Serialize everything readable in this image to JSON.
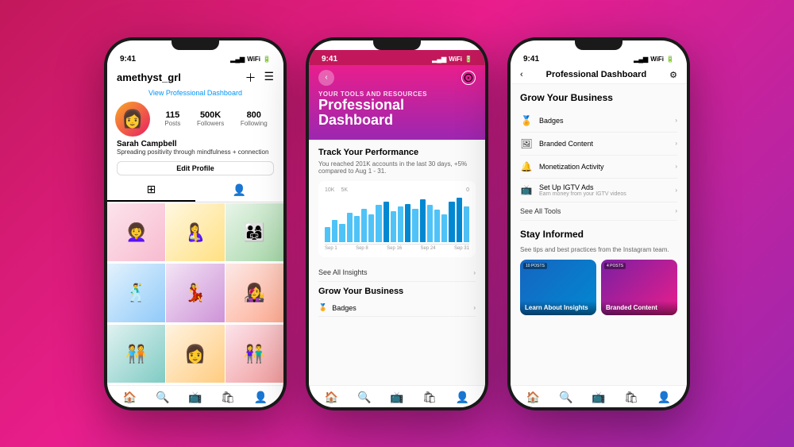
{
  "background": {
    "gradient": "linear-gradient(135deg, #c2185b 0%, #e91e8c 40%, #9c27b0 100%)"
  },
  "phone1": {
    "time": "9:41",
    "username": "amethyst_grl",
    "view_dash": "View Professional Dashboard",
    "stats": {
      "posts": {
        "value": "115",
        "label": "Posts"
      },
      "followers": {
        "value": "500K",
        "label": "Followers"
      },
      "following": {
        "value": "800",
        "label": "Following"
      }
    },
    "bio_name": "Sarah Campbell",
    "bio_text": "Spreading positivity through mindfulness + connection",
    "edit_btn": "Edit Profile",
    "grid_count": 9
  },
  "phone2": {
    "time": "9:41",
    "subtitle": "Your Tools and Resources",
    "title_line1": "Professional",
    "title_line2": "Dashboard",
    "track_title": "Track Your Performance",
    "track_desc": "You reached 201K accounts in the last 30 days, +5% compared to Aug 1 - 31.",
    "chart_labels": {
      "top": [
        "10K",
        "5K",
        "0"
      ],
      "x": [
        "Sep 1",
        "Sep 8",
        "Sep 16",
        "Sep 24",
        "Sep 31"
      ]
    },
    "bar_heights": [
      20,
      30,
      25,
      40,
      35,
      45,
      38,
      50,
      55,
      42,
      48,
      52,
      45,
      58,
      50,
      44,
      38,
      55,
      60,
      48
    ],
    "see_insights": "See All Insights",
    "grow_title": "Grow Your Business",
    "menu_items": [
      {
        "icon": "🏅",
        "label": "Badges"
      }
    ]
  },
  "phone3": {
    "time": "9:41",
    "title": "Professional Dashboard",
    "grow_section": "Grow Your Business",
    "stay_section": "Stay Informed",
    "stay_desc": "See tips and best practices from the Instagram team.",
    "menu_items": [
      {
        "icon": "🏅",
        "label": "Badges",
        "sub": ""
      },
      {
        "icon": "🖼",
        "label": "Branded Content",
        "sub": ""
      },
      {
        "icon": "🔔",
        "label": "Monetization Activity",
        "sub": ""
      },
      {
        "icon": "📺",
        "label": "Set Up IGTV Ads",
        "sub": "Earn money from your IGTV videos"
      }
    ],
    "see_all": "See All Tools",
    "cards": [
      {
        "tag": "10 POSTS",
        "title": "Learn About Insights",
        "bg": "bg1"
      },
      {
        "tag": "4 POSTS",
        "title": "Branded Content",
        "bg": "bg2"
      }
    ]
  },
  "nav_icons": [
    "🏠",
    "🔍",
    "📺",
    "🛍",
    "👤"
  ]
}
